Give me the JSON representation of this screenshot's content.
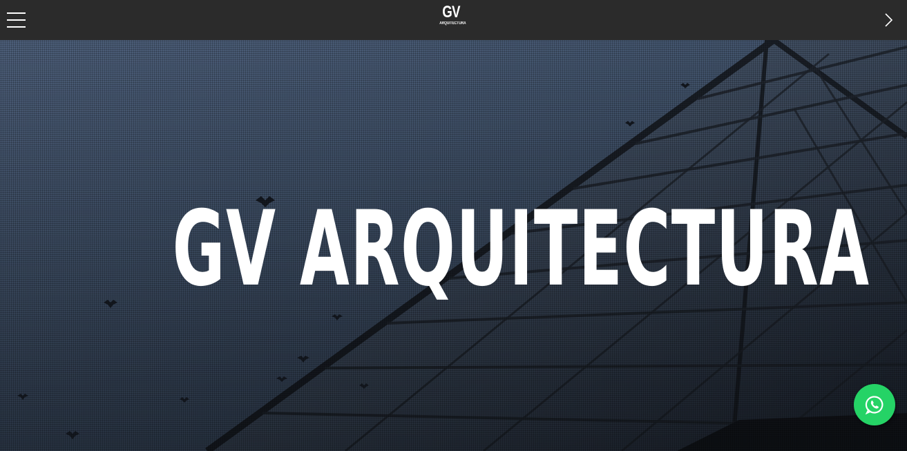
{
  "header": {
    "menu_icon": "hamburger-menu-icon",
    "logo": {
      "main": "GV",
      "sub": "ARQUITECTURA"
    },
    "next_icon": "chevron-right-icon"
  },
  "hero": {
    "title": "GV ARQUITECTURA",
    "background": "photo of steel glass roof structure with birds against dusky sky"
  },
  "floating": {
    "whatsapp_icon": "whatsapp-icon",
    "color": "#25d366"
  },
  "colors": {
    "topbar": "#2b2b2b",
    "text": "#ffffff"
  }
}
